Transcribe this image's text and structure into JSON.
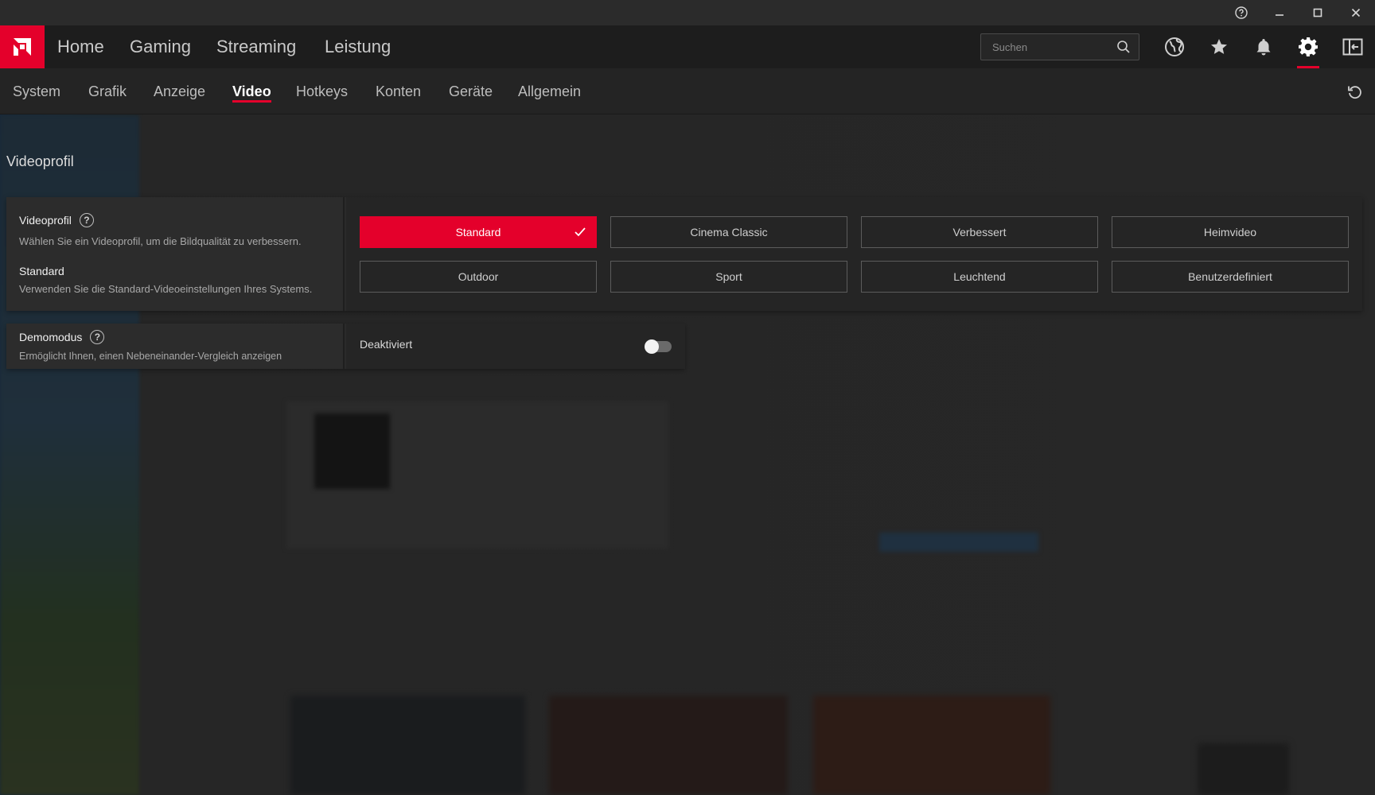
{
  "window": {
    "help_icon": "help-circle-icon",
    "minimize_icon": "minimize-icon",
    "maximize_icon": "maximize-icon",
    "close_icon": "close-icon"
  },
  "main_nav": {
    "items": [
      "Home",
      "Gaming",
      "Streaming",
      "Leistung"
    ]
  },
  "search": {
    "placeholder": "Suchen"
  },
  "sub_nav": {
    "items": [
      "System",
      "Grafik",
      "Anzeige",
      "Video",
      "Hotkeys",
      "Konten",
      "Geräte",
      "Allgemein"
    ],
    "active": "Video"
  },
  "section": {
    "title": "Videoprofil"
  },
  "video_profile": {
    "title": "Videoprofil",
    "description": "Wählen Sie ein Videoprofil, um die Bildqualität zu verbessern.",
    "selected_title": "Standard",
    "selected_description": "Verwenden Sie die Standard-Videoeinstellungen Ihres Systems.",
    "options": [
      "Standard",
      "Cinema Classic",
      "Verbessert",
      "Heimvideo",
      "Outdoor",
      "Sport",
      "Leuchtend",
      "Benutzerdefiniert"
    ],
    "selected": "Standard"
  },
  "demo_mode": {
    "title": "Demomodus",
    "description": "Ermöglicht Ihnen, einen Nebeneinander-Vergleich anzeigen",
    "state_label": "Deaktiviert",
    "enabled": false
  },
  "colors": {
    "accent": "#e4002b",
    "background": "#272727",
    "card": "#2a2a2a"
  }
}
